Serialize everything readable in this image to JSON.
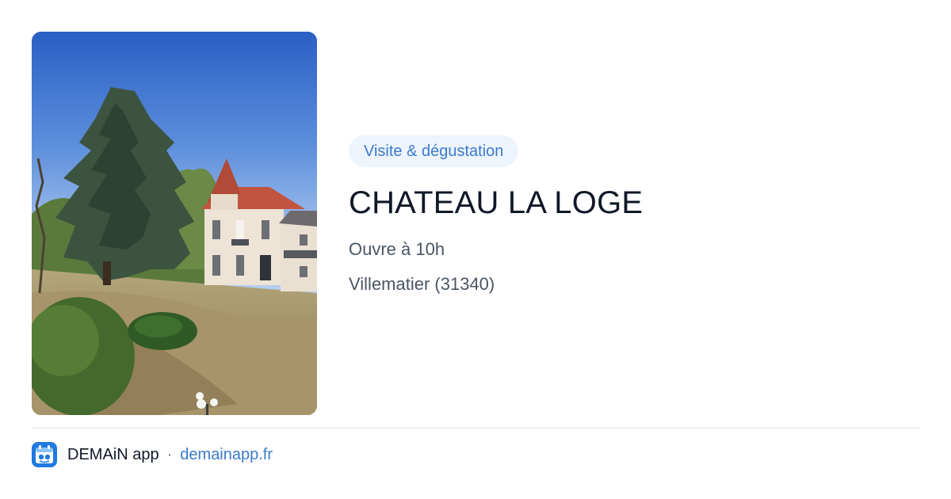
{
  "card": {
    "image_alt": "Château building with tall cedar tree and garden under blue sky",
    "tag": "Visite & dégustation",
    "title": "CHATEAU LA LOGE",
    "hours": "Ouvre à 10h",
    "location": "Villematier (31340)"
  },
  "footer": {
    "app_icon": "demain-app-icon",
    "app_name": "DEMAiN app",
    "separator": "·",
    "url": "demainapp.fr"
  },
  "colors": {
    "accent": "#3b7bcc",
    "tag_background": "#eef4fc",
    "title": "#101828",
    "secondary_text": "#4a5565",
    "divider": "#d9e2ea",
    "app_icon_blue": "#1f7ae0"
  }
}
